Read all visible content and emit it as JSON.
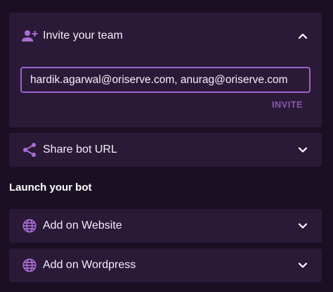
{
  "invite": {
    "title": "Invite your team",
    "input_value": "hardik.agarwal@oriserve.com, anurag@oriserve.com",
    "button_label": "INVITE",
    "expanded": true
  },
  "share": {
    "title": "Share bot URL",
    "expanded": false
  },
  "launch": {
    "section_title": "Launch your bot",
    "items": [
      {
        "title": "Add on Website",
        "icon": "globe-icon"
      },
      {
        "title": "Add on Wordpress",
        "icon": "globe-icon"
      }
    ]
  },
  "colors": {
    "background": "#1b1023",
    "card": "#2a1a38",
    "accent": "#9e62c9",
    "icon": "#a96ed3",
    "text": "#f4eef8"
  },
  "icons": {
    "invite": "person-add-icon",
    "share": "share-icon",
    "collapse": "chevron-up-icon",
    "expand": "chevron-down-icon"
  }
}
